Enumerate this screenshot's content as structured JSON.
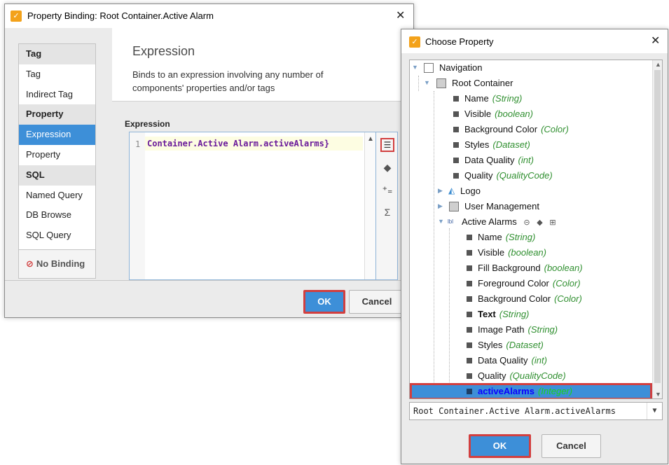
{
  "colors": {
    "accent": "#3d8fd8",
    "highlight": "#d23f3f",
    "type_text": "#2f8f2f"
  },
  "binding_dialog": {
    "title": "Property Binding: Root Container.Active Alarm",
    "close_icon": "close-icon",
    "sidebar": [
      {
        "label": "Tag",
        "kind": "category"
      },
      {
        "label": "Tag",
        "kind": "item"
      },
      {
        "label": "Indirect Tag",
        "kind": "item"
      },
      {
        "label": "Property",
        "kind": "category"
      },
      {
        "label": "Expression",
        "kind": "item",
        "selected": true
      },
      {
        "label": "Property",
        "kind": "item"
      },
      {
        "label": "SQL",
        "kind": "category"
      },
      {
        "label": "Named Query",
        "kind": "item"
      },
      {
        "label": "DB Browse",
        "kind": "item"
      },
      {
        "label": "SQL Query",
        "kind": "item"
      }
    ],
    "no_binding_label": "No Binding",
    "heading": "Expression",
    "description": "Binds to an expression involving any number of components' properties and/or tags",
    "editor_label": "Expression",
    "editor": {
      "line_number": "1",
      "code": "Container.Active Alarm.activeAlarms}"
    },
    "tools": [
      "property-picker-icon",
      "tag-icon",
      "operator-icon",
      "function-sigma-icon"
    ],
    "ok_label": "OK",
    "cancel_label": "Cancel"
  },
  "chooser_dialog": {
    "title": "Choose Property",
    "tree": [
      {
        "name": "Navigation",
        "type": ""
      },
      {
        "name": "Root Container",
        "type": ""
      },
      {
        "name": "Name",
        "type": "(String)"
      },
      {
        "name": "Visible",
        "type": "(boolean)"
      },
      {
        "name": "Background Color",
        "type": "(Color)"
      },
      {
        "name": "Styles",
        "type": "(Dataset)"
      },
      {
        "name": "Data Quality",
        "type": "(int)"
      },
      {
        "name": "Quality",
        "type": "(QualityCode)"
      },
      {
        "name": "Logo",
        "type": ""
      },
      {
        "name": "User Management",
        "type": ""
      },
      {
        "name": "Active Alarms",
        "type": ""
      },
      {
        "name": "Name",
        "type": "(String)"
      },
      {
        "name": "Visible",
        "type": "(boolean)"
      },
      {
        "name": "Fill Background",
        "type": "(boolean)"
      },
      {
        "name": "Foreground Color",
        "type": "(Color)"
      },
      {
        "name": "Background Color",
        "type": "(Color)"
      },
      {
        "name": "Text",
        "type": "(String)"
      },
      {
        "name": "Image Path",
        "type": "(String)"
      },
      {
        "name": "Styles",
        "type": "(Dataset)"
      },
      {
        "name": "Data Quality",
        "type": "(int)"
      },
      {
        "name": "Quality",
        "type": "(QualityCode)"
      },
      {
        "name": "activeAlarms",
        "type": "(Integer)"
      }
    ],
    "selected_path": "Root Container.Active Alarm.activeAlarms",
    "ok_label": "OK",
    "cancel_label": "Cancel"
  }
}
